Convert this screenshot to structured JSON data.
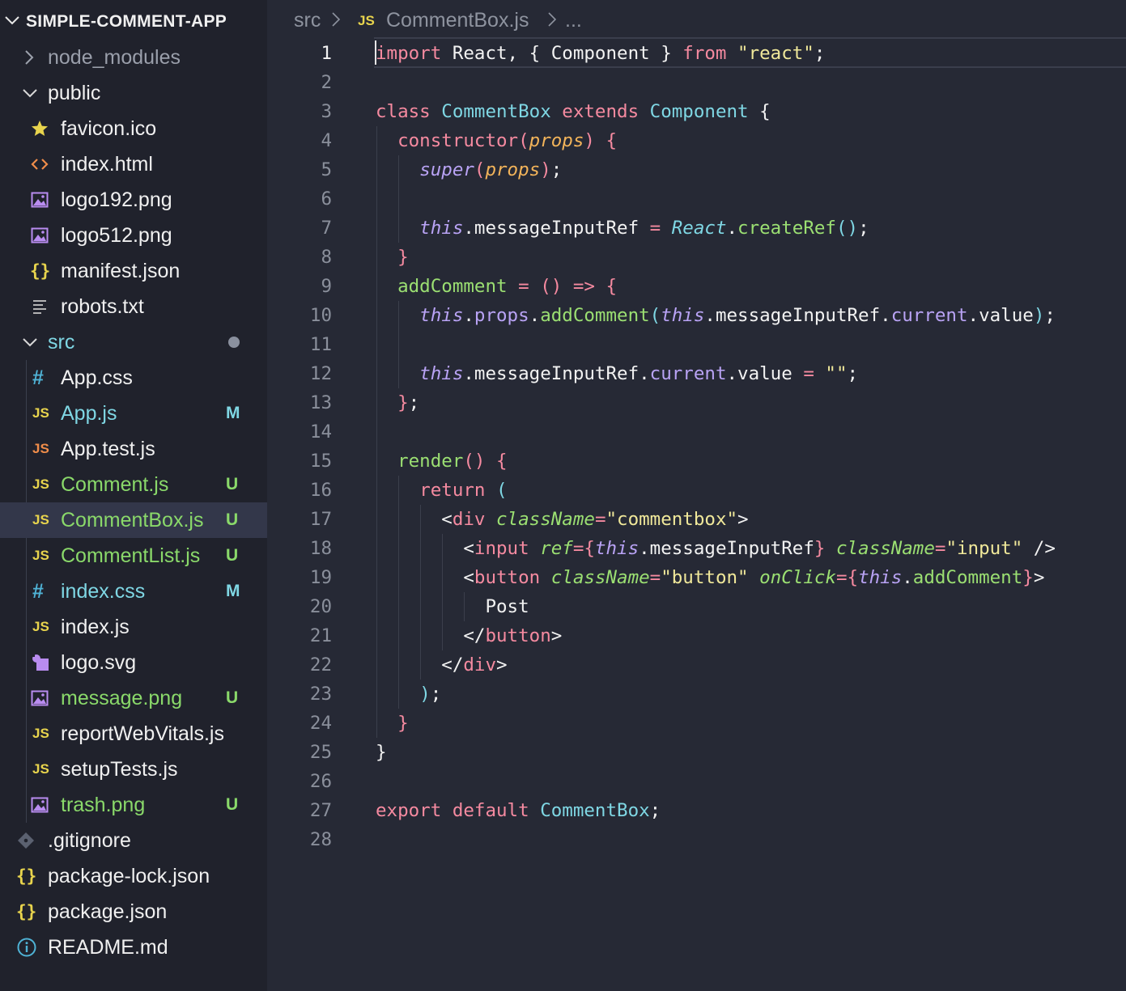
{
  "explorer": {
    "title": "SIMPLE-COMMENT-APP",
    "items": [
      {
        "label": "node_modules",
        "type": "folder-collapsed",
        "muted": true
      },
      {
        "label": "public",
        "type": "folder-open"
      },
      {
        "label": "favicon.ico",
        "type": "star",
        "icon": "star-icon"
      },
      {
        "label": "index.html",
        "type": "html",
        "icon": "html-icon"
      },
      {
        "label": "logo192.png",
        "type": "image",
        "icon": "image-icon"
      },
      {
        "label": "logo512.png",
        "type": "image",
        "icon": "image-icon"
      },
      {
        "label": "manifest.json",
        "type": "json",
        "icon": "json-icon",
        "glyph": "{}"
      },
      {
        "label": "robots.txt",
        "type": "text",
        "icon": "text-file-icon"
      },
      {
        "label": "src",
        "type": "folder-open",
        "modified_dot": true
      },
      {
        "label": "App.css",
        "type": "css",
        "icon": "css-icon",
        "glyph": "#"
      },
      {
        "label": "App.js",
        "type": "js",
        "icon": "js-icon",
        "glyph": "JS",
        "status": "M"
      },
      {
        "label": "App.test.js",
        "type": "js",
        "icon": "test-js-icon",
        "glyph": "JS"
      },
      {
        "label": "Comment.js",
        "type": "js",
        "icon": "js-icon",
        "glyph": "JS",
        "status": "U"
      },
      {
        "label": "CommentBox.js",
        "type": "js",
        "icon": "js-icon",
        "glyph": "JS",
        "status": "U",
        "selected": true
      },
      {
        "label": "CommentList.js",
        "type": "js",
        "icon": "js-icon",
        "glyph": "JS",
        "status": "U"
      },
      {
        "label": "index.css",
        "type": "css",
        "icon": "css-icon",
        "glyph": "#",
        "status": "M"
      },
      {
        "label": "index.js",
        "type": "js",
        "icon": "js-icon",
        "glyph": "JS"
      },
      {
        "label": "logo.svg",
        "type": "svg",
        "icon": "svg-icon"
      },
      {
        "label": "message.png",
        "type": "image",
        "icon": "image-icon",
        "status": "U"
      },
      {
        "label": "reportWebVitals.js",
        "type": "js",
        "icon": "js-icon",
        "glyph": "JS"
      },
      {
        "label": "setupTests.js",
        "type": "js",
        "icon": "js-icon",
        "glyph": "JS"
      },
      {
        "label": "trash.png",
        "type": "image",
        "icon": "image-icon",
        "status": "U"
      },
      {
        "label": ".gitignore",
        "type": "git",
        "icon": "git-icon"
      },
      {
        "label": "package-lock.json",
        "type": "json",
        "icon": "json-icon",
        "glyph": "{}"
      },
      {
        "label": "package.json",
        "type": "json",
        "icon": "json-icon",
        "glyph": "{}"
      },
      {
        "label": "README.md",
        "type": "info",
        "icon": "info-icon"
      }
    ]
  },
  "breadcrumb": {
    "folder": "src",
    "file_glyph": "JS",
    "file": "CommentBox.js",
    "more": "..."
  },
  "editor": {
    "active_line": 1,
    "lines": [
      [
        [
          "import",
          "kw"
        ],
        [
          " React, { Component } ",
          "tx"
        ],
        [
          "from",
          "kw"
        ],
        [
          " ",
          "tx"
        ],
        [
          "\"react\"",
          "str"
        ],
        [
          ";",
          "tx"
        ]
      ],
      [],
      [
        [
          "class",
          "kw"
        ],
        [
          " ",
          "tx"
        ],
        [
          "CommentBox",
          "cls"
        ],
        [
          " ",
          "tx"
        ],
        [
          "extends",
          "kw"
        ],
        [
          " ",
          "tx"
        ],
        [
          "Component",
          "cls"
        ],
        [
          " {",
          "tx"
        ]
      ],
      [
        [
          "  ",
          "tx"
        ],
        [
          "constructor",
          "kw"
        ],
        [
          "(",
          "pun"
        ],
        [
          "props",
          "param"
        ],
        [
          ")",
          "pun"
        ],
        [
          " {",
          "br"
        ]
      ],
      [
        [
          "    ",
          "tx"
        ],
        [
          "super",
          "itp"
        ],
        [
          "(",
          "pun"
        ],
        [
          "props",
          "param"
        ],
        [
          ")",
          "pun"
        ],
        [
          ";",
          "tx"
        ]
      ],
      [],
      [
        [
          "    ",
          "tx"
        ],
        [
          "this",
          "itp"
        ],
        [
          ".messageInputRef ",
          "tx"
        ],
        [
          "=",
          "op"
        ],
        [
          " ",
          "tx"
        ],
        [
          "React",
          "cls-it"
        ],
        [
          ".",
          "tx"
        ],
        [
          "createRef",
          "fn"
        ],
        [
          "()",
          "pun2"
        ],
        [
          ";",
          "tx"
        ]
      ],
      [
        [
          "  ",
          "tx"
        ],
        [
          "}",
          "br"
        ]
      ],
      [
        [
          "  ",
          "tx"
        ],
        [
          "addComment",
          "fn"
        ],
        [
          " ",
          "tx"
        ],
        [
          "=",
          "op"
        ],
        [
          " ",
          "tx"
        ],
        [
          "()",
          "br"
        ],
        [
          " ",
          "tx"
        ],
        [
          "=>",
          "op"
        ],
        [
          " ",
          "tx"
        ],
        [
          "{",
          "br"
        ]
      ],
      [
        [
          "    ",
          "tx"
        ],
        [
          "this",
          "itp"
        ],
        [
          ".",
          "tx"
        ],
        [
          "props",
          "prop"
        ],
        [
          ".",
          "tx"
        ],
        [
          "addComment",
          "fn"
        ],
        [
          "(",
          "pun2"
        ],
        [
          "this",
          "itp"
        ],
        [
          ".messageInputRef.",
          "tx"
        ],
        [
          "current",
          "prop"
        ],
        [
          ".value",
          "tx"
        ],
        [
          ")",
          "pun2"
        ],
        [
          ";",
          "tx"
        ]
      ],
      [],
      [
        [
          "    ",
          "tx"
        ],
        [
          "this",
          "itp"
        ],
        [
          ".messageInputRef.",
          "tx"
        ],
        [
          "current",
          "prop"
        ],
        [
          ".value ",
          "tx"
        ],
        [
          "=",
          "op"
        ],
        [
          " ",
          "tx"
        ],
        [
          "\"\"",
          "str"
        ],
        [
          ";",
          "tx"
        ]
      ],
      [
        [
          "  ",
          "tx"
        ],
        [
          "}",
          "br"
        ],
        [
          ";",
          "tx"
        ]
      ],
      [],
      [
        [
          "  ",
          "tx"
        ],
        [
          "render",
          "fn"
        ],
        [
          "()",
          "pun"
        ],
        [
          " ",
          "tx"
        ],
        [
          "{",
          "br"
        ]
      ],
      [
        [
          "    ",
          "tx"
        ],
        [
          "return",
          "kw"
        ],
        [
          " ",
          "tx"
        ],
        [
          "(",
          "pun2"
        ]
      ],
      [
        [
          "      ",
          "tx"
        ],
        [
          "<",
          "tx"
        ],
        [
          "div",
          "kw"
        ],
        [
          " ",
          "tx"
        ],
        [
          "className",
          "attr"
        ],
        [
          "=",
          "op"
        ],
        [
          "\"commentbox\"",
          "str"
        ],
        [
          ">",
          "tx"
        ]
      ],
      [
        [
          "        ",
          "tx"
        ],
        [
          "<",
          "tx"
        ],
        [
          "input",
          "kw"
        ],
        [
          " ",
          "tx"
        ],
        [
          "ref",
          "attr"
        ],
        [
          "=",
          "op"
        ],
        [
          "{",
          "br"
        ],
        [
          "this",
          "itp"
        ],
        [
          ".messageInputRef",
          "tx"
        ],
        [
          "}",
          "br"
        ],
        [
          " ",
          "tx"
        ],
        [
          "className",
          "attr"
        ],
        [
          "=",
          "op"
        ],
        [
          "\"input\"",
          "str"
        ],
        [
          " />",
          "tx"
        ]
      ],
      [
        [
          "        ",
          "tx"
        ],
        [
          "<",
          "tx"
        ],
        [
          "button",
          "kw"
        ],
        [
          " ",
          "tx"
        ],
        [
          "className",
          "attr"
        ],
        [
          "=",
          "op"
        ],
        [
          "\"button\"",
          "str"
        ],
        [
          " ",
          "tx"
        ],
        [
          "onClick",
          "attr"
        ],
        [
          "=",
          "op"
        ],
        [
          "{",
          "br"
        ],
        [
          "this",
          "itp"
        ],
        [
          ".",
          "tx"
        ],
        [
          "addComment",
          "fn"
        ],
        [
          "}",
          "br"
        ],
        [
          ">",
          "tx"
        ]
      ],
      [
        [
          "          Post",
          "tx"
        ]
      ],
      [
        [
          "        ",
          "tx"
        ],
        [
          "</",
          "tx"
        ],
        [
          "button",
          "kw"
        ],
        [
          ">",
          "tx"
        ]
      ],
      [
        [
          "      ",
          "tx"
        ],
        [
          "</",
          "tx"
        ],
        [
          "div",
          "kw"
        ],
        [
          ">",
          "tx"
        ]
      ],
      [
        [
          "    ",
          "tx"
        ],
        [
          ")",
          "pun2"
        ],
        [
          ";",
          "tx"
        ]
      ],
      [
        [
          "  ",
          "tx"
        ],
        [
          "}",
          "br"
        ]
      ],
      [
        [
          "}",
          "tx"
        ]
      ],
      [],
      [
        [
          "export",
          "kw"
        ],
        [
          " ",
          "tx"
        ],
        [
          "default",
          "kw"
        ],
        [
          " ",
          "tx"
        ],
        [
          "CommentBox",
          "cls"
        ],
        [
          ";",
          "tx"
        ]
      ],
      []
    ]
  },
  "colors": {
    "kw": "#f58aa0",
    "cls": "#7fd7e4",
    "cls-it": "#7fd7e4",
    "fn": "#9bdf72",
    "str": "#f0e89a",
    "param": "#f3b45a",
    "itp": "#b9a3f5",
    "prop": "#b9a3f5",
    "attr": "#9bdf72",
    "op": "#f58aa0",
    "br": "#f58aa0",
    "pun": "#f58aa0",
    "pun2": "#7fd7e4",
    "tx": "#f2f2f2",
    "status_M": "#7fd7e4",
    "status_U": "#8ad96a"
  }
}
